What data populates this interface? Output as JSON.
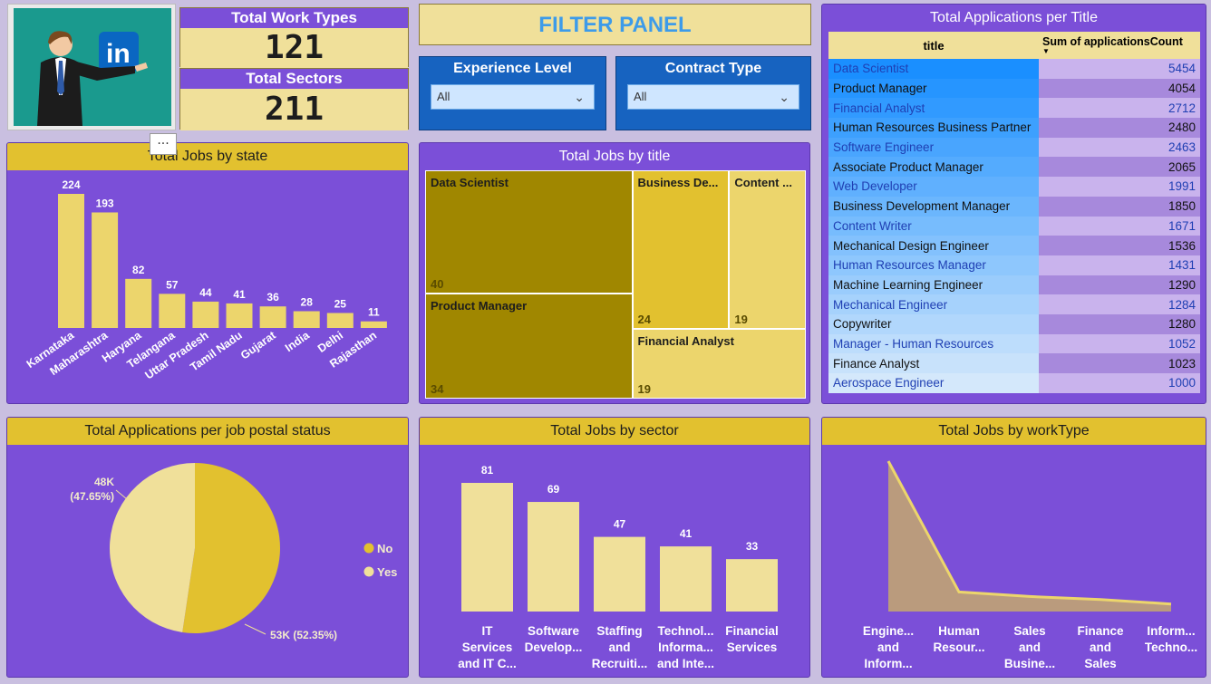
{
  "kpis": {
    "work_types_label": "Total Work Types",
    "work_types_value": "121",
    "sectors_label": "Total Sectors",
    "sectors_value": "211"
  },
  "filter_panel": {
    "title": "FILTER PANEL",
    "experience_label": "Experience Level",
    "experience_value": "All",
    "contract_label": "Contract Type",
    "contract_value": "All"
  },
  "visual_menu": "···",
  "colors": {
    "panel": "#7b4fd8",
    "header": "#e2c12f",
    "bar": "#ecd56c",
    "treemap_dark": "#a08700",
    "treemap_mid": "#e2c12f",
    "treemap_light": "#ecd56c",
    "pie_no": "#e2c12f",
    "pie_yes": "#f0e09a"
  },
  "chart_data": [
    {
      "id": "jobs_by_state",
      "type": "bar",
      "title": "Total Jobs by state",
      "categories": [
        "Karnataka",
        "Maharashtra",
        "Haryana",
        "Telangana",
        "Uttar Pradesh",
        "Tamil Nadu",
        "Gujarat",
        "India",
        "Delhi",
        "Rajasthan"
      ],
      "values": [
        224,
        193,
        82,
        57,
        44,
        41,
        36,
        28,
        25,
        11
      ],
      "value_labels": [
        "224",
        "193",
        "82",
        "57",
        "44",
        "41",
        "36",
        "28",
        "25",
        "11"
      ],
      "ylim": [
        0,
        224
      ]
    },
    {
      "id": "jobs_by_title",
      "type": "treemap",
      "title": "Total Jobs by title",
      "items": [
        {
          "label": "Data Scientist",
          "value": 40,
          "value_label": "40"
        },
        {
          "label": "Product Manager",
          "value": 34,
          "value_label": "34"
        },
        {
          "label": "Business De...",
          "value": 24,
          "value_label": "24"
        },
        {
          "label": "Content ...",
          "value": 19,
          "value_label": "19"
        },
        {
          "label": "Financial Analyst",
          "value": 19,
          "value_label": "19"
        }
      ]
    },
    {
      "id": "applications_per_title",
      "type": "table",
      "title": "Total Applications per Title",
      "columns": [
        "title",
        "Sum of applicationsCount"
      ],
      "rows": [
        {
          "title": "Data Scientist",
          "count": "5454",
          "value": 5454
        },
        {
          "title": "Product Manager",
          "count": "4054",
          "value": 4054
        },
        {
          "title": "Financial Analyst",
          "count": "2712",
          "value": 2712
        },
        {
          "title": "Human Resources Business Partner",
          "count": "2480",
          "value": 2480
        },
        {
          "title": "Software Engineer",
          "count": "2463",
          "value": 2463
        },
        {
          "title": "Associate Product Manager",
          "count": "2065",
          "value": 2065
        },
        {
          "title": "Web Developer",
          "count": "1991",
          "value": 1991
        },
        {
          "title": "Business Development Manager",
          "count": "1850",
          "value": 1850
        },
        {
          "title": "Content Writer",
          "count": "1671",
          "value": 1671
        },
        {
          "title": "Mechanical Design Engineer",
          "count": "1536",
          "value": 1536
        },
        {
          "title": "Human Resources Manager",
          "count": "1431",
          "value": 1431
        },
        {
          "title": "Machine Learning Engineer",
          "count": "1290",
          "value": 1290
        },
        {
          "title": "Mechanical Engineer",
          "count": "1284",
          "value": 1284
        },
        {
          "title": "Copywriter",
          "count": "1280",
          "value": 1280
        },
        {
          "title": "Manager - Human Resources",
          "count": "1052",
          "value": 1052
        },
        {
          "title": "Finance Analyst",
          "count": "1023",
          "value": 1023
        },
        {
          "title": "Aerospace Engineer",
          "count": "1000",
          "value": 1000
        }
      ]
    },
    {
      "id": "applications_by_postal_status",
      "type": "pie",
      "title": "Total Applications per job postal status",
      "slices": [
        {
          "label": "No",
          "value": 52.35,
          "data_label": "53K (52.35%)"
        },
        {
          "label": "Yes",
          "value": 47.65,
          "data_label_line1": "48K",
          "data_label_line2": "(47.65%)"
        }
      ],
      "legend_position": "right"
    },
    {
      "id": "jobs_by_sector",
      "type": "bar",
      "title": "Total Jobs by sector",
      "categories": [
        [
          "IT",
          "Services",
          "and IT C..."
        ],
        [
          "Software",
          "Develop..."
        ],
        [
          "Staffing",
          "and",
          "Recruiti..."
        ],
        [
          "Technol...",
          "Informa...",
          "and Inte..."
        ],
        [
          "Financial",
          "Services"
        ]
      ],
      "values": [
        81,
        69,
        47,
        41,
        33
      ],
      "value_labels": [
        "81",
        "69",
        "47",
        "41",
        "33"
      ],
      "ylim": [
        0,
        81
      ]
    },
    {
      "id": "jobs_by_worktype",
      "type": "area",
      "title": "Total Jobs by workType",
      "categories": [
        [
          "Engine...",
          "and",
          "Inform..."
        ],
        [
          "Human",
          "Resour..."
        ],
        [
          "Sales",
          "and",
          "Busine..."
        ],
        [
          "Finance",
          "and",
          "Sales"
        ],
        [
          "Inform...",
          "Techno..."
        ]
      ],
      "values": [
        100,
        13,
        10,
        8,
        5
      ],
      "ylim": [
        0,
        100
      ]
    }
  ]
}
